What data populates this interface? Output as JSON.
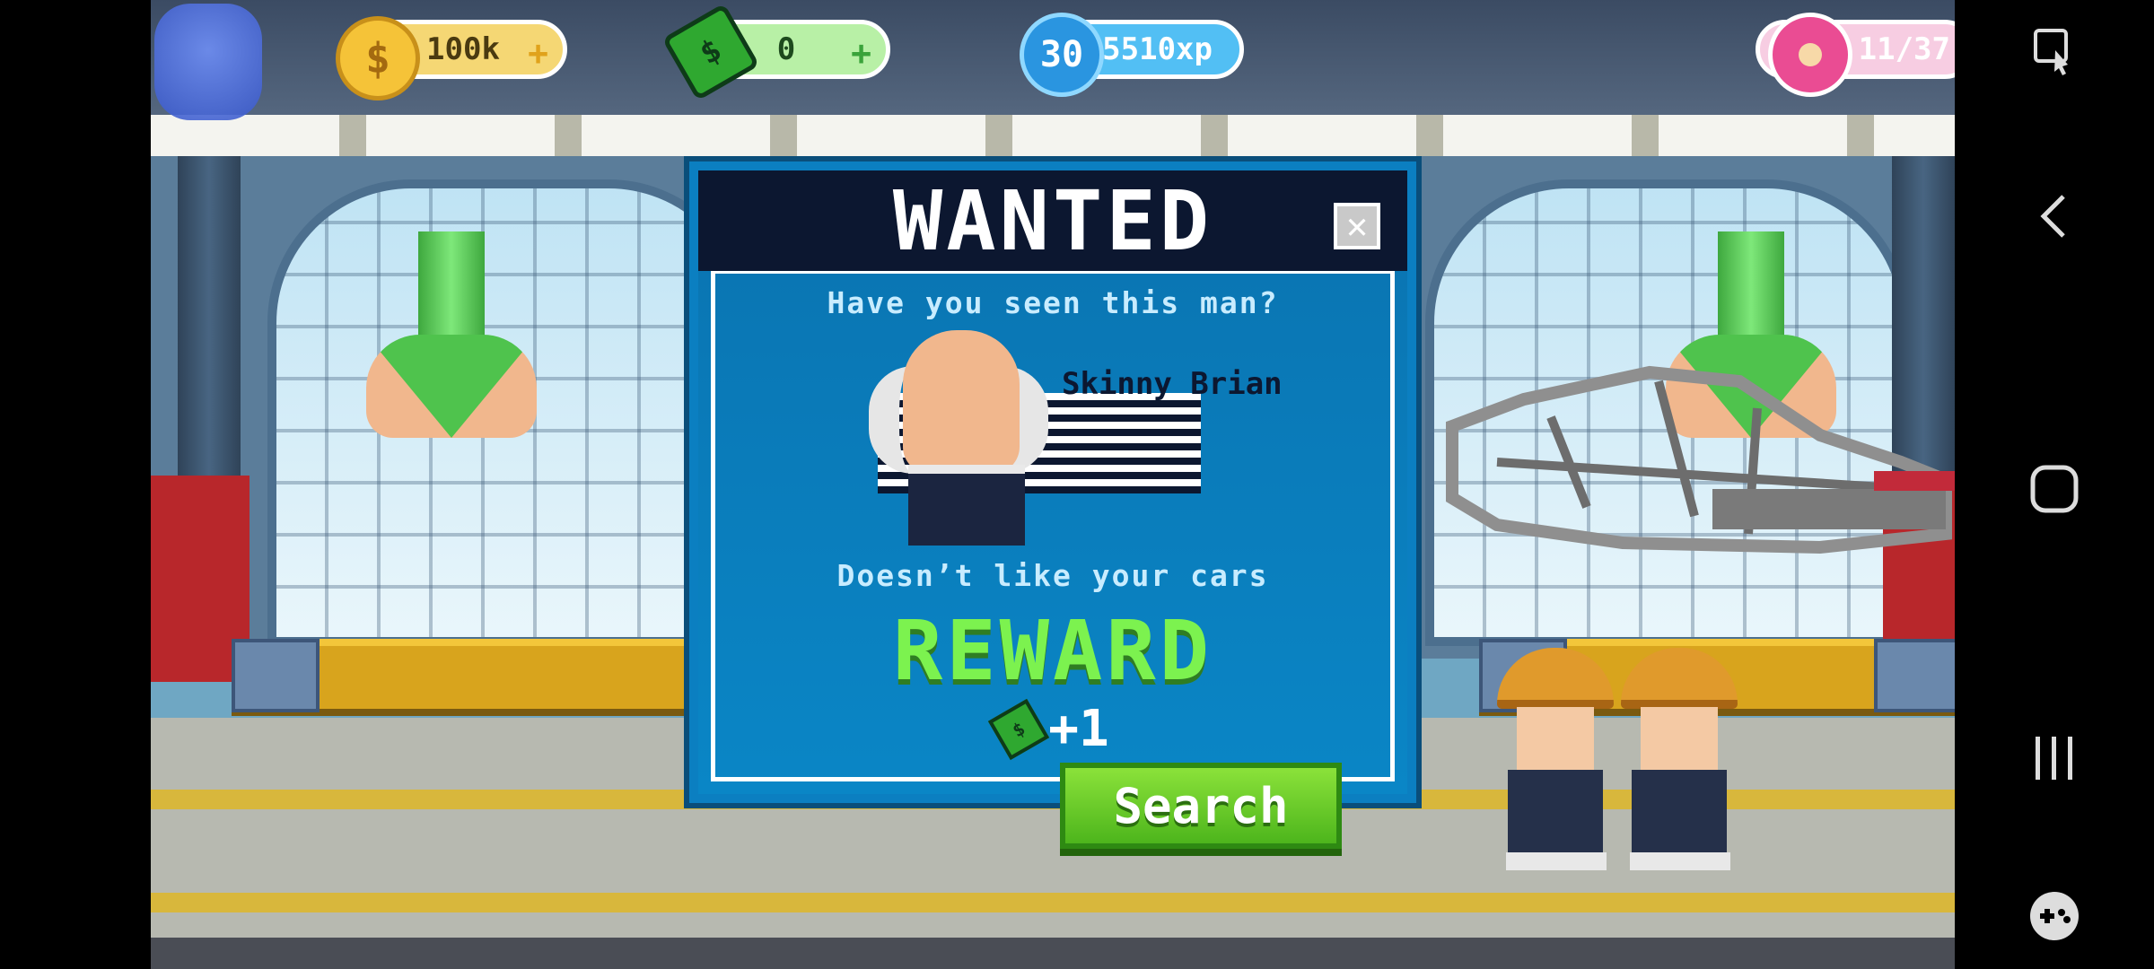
{
  "hud": {
    "coins": {
      "value": "100k",
      "plus": "+"
    },
    "cash": {
      "value": "0",
      "plus": "+"
    },
    "level": {
      "value": "30",
      "xp": "125510xp"
    },
    "donuts": {
      "value": "11/37"
    }
  },
  "modal": {
    "title": "WANTED",
    "close_label": "✕",
    "subtitle": "Have you seen this man?",
    "suspect_name": "Skinny Brian",
    "description": "Doesn’t like your cars",
    "reward_label": "REWARD",
    "reward_amount": "+1",
    "search_button": "Search"
  },
  "navbar": {
    "icons": [
      "screen-capture-icon",
      "back-icon",
      "home-icon",
      "recents-icon",
      "game-tools-icon"
    ]
  },
  "colors": {
    "modal_blue": "#0a86c6",
    "reward_green": "#7cf24f",
    "search_green": "#4db51c",
    "coin_gold": "#f5c338",
    "donut_pink": "#ea4c93"
  }
}
